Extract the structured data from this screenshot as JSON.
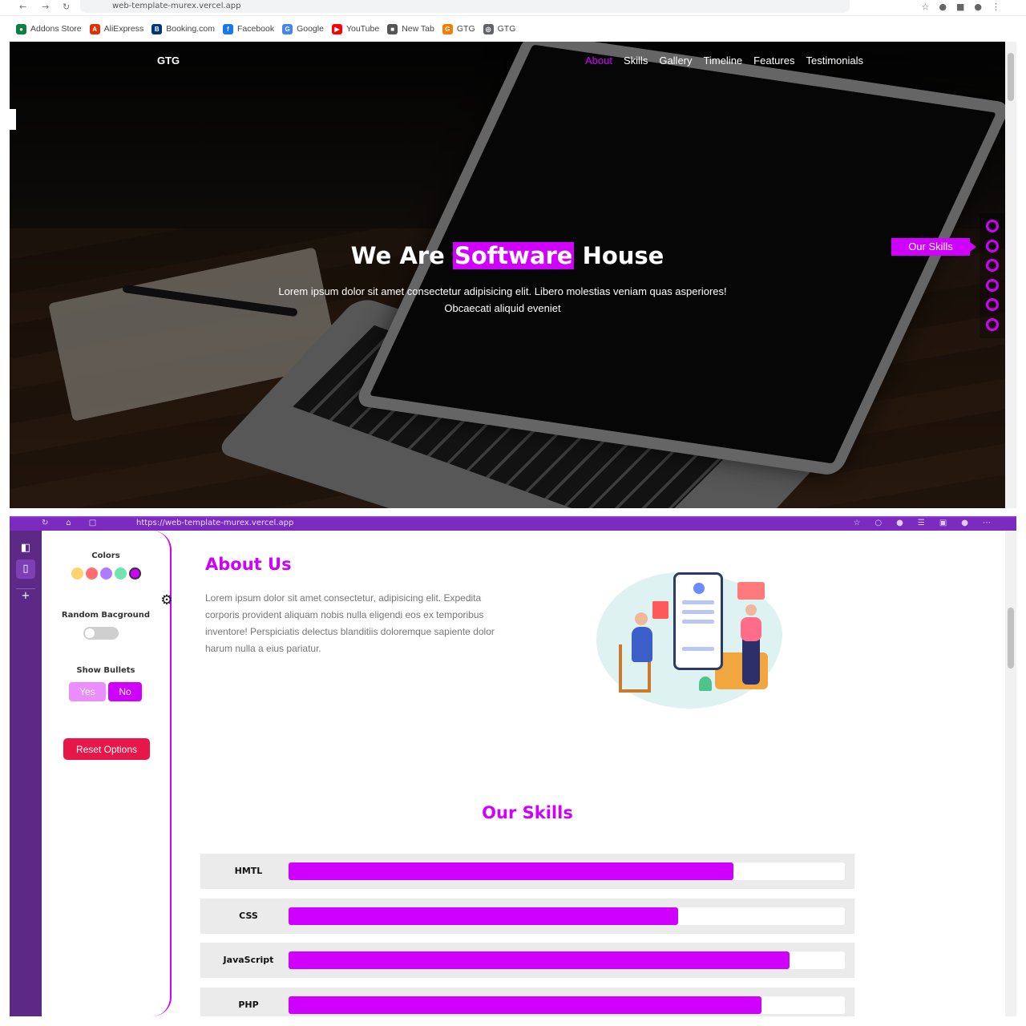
{
  "browser_top": {
    "url": "web-template-murex.vercel.app",
    "bookmarks": [
      {
        "label": "Addons Store",
        "icon": "addons-store-icon",
        "color": "#0b8043",
        "glyph": "●"
      },
      {
        "label": "AliExpress",
        "icon": "aliexpress-icon",
        "color": "#e62e04",
        "glyph": "A"
      },
      {
        "label": "Booking.com",
        "icon": "booking-icon",
        "color": "#003580",
        "glyph": "B"
      },
      {
        "label": "Facebook",
        "icon": "facebook-icon",
        "color": "#1877f2",
        "glyph": "f"
      },
      {
        "label": "Google",
        "icon": "google-icon",
        "color": "#4285f4",
        "glyph": "G"
      },
      {
        "label": "YouTube",
        "icon": "youtube-icon",
        "color": "#ff0000",
        "glyph": "▶"
      },
      {
        "label": "New Tab",
        "icon": "new-tab-icon",
        "color": "#555555",
        "glyph": "■"
      },
      {
        "label": "GTG",
        "icon": "gtg-icon",
        "color": "#f57c00",
        "glyph": "G"
      },
      {
        "label": "GTG",
        "icon": "globe-icon",
        "color": "#5f6368",
        "glyph": "◎"
      }
    ]
  },
  "hero": {
    "logo": "GTG",
    "nav": [
      {
        "label": "About",
        "active": true
      },
      {
        "label": "Skills",
        "active": false
      },
      {
        "label": "Gallery",
        "active": false
      },
      {
        "label": "Timeline",
        "active": false
      },
      {
        "label": "Features",
        "active": false
      },
      {
        "label": "Testimonials",
        "active": false
      }
    ],
    "headline_pre": "We Are ",
    "headline_highlight": "Software",
    "headline_post": " House",
    "lead": "Lorem ipsum dolor sit amet consectetur adipisicing elit. Libero molestias veniam quas asperiores! Obcaecati aliquid eveniet",
    "bullet_tooltip": "Our Skills",
    "bullet_count": 6
  },
  "browser_bottom": {
    "url": "https://web-template-murex.vercel.app"
  },
  "settings": {
    "colors_label": "Colors",
    "swatches": [
      "#ffd36e",
      "#ff6f6f",
      "#b07cff",
      "#6fe3b1",
      "#d000ff"
    ],
    "active_swatch": "#d000ff",
    "random_bg_label": "Random Bacground",
    "random_bg_on": false,
    "show_bullets_label": "Show Bullets",
    "yes_label": "Yes",
    "no_label": "No",
    "reset_label": "Reset Options"
  },
  "about": {
    "title": "About Us",
    "text": "Lorem ipsum dolor sit amet consectetur, adipisicing elit. Expedita corporis provident aliquam nobis nulla eligendi eos ex temporibus inventore! Perspiciatis delectus blanditiis doloremque sapiente dolor harum nulla a eius pariatur."
  },
  "skills": {
    "title": "Our Skills",
    "items": [
      {
        "name": "HMTL",
        "progress": 80
      },
      {
        "name": "CSS",
        "progress": 70
      },
      {
        "name": "JavaScript",
        "progress": 90
      },
      {
        "name": "PHP",
        "progress": 85
      }
    ]
  },
  "colors": {
    "accent": "#d000ff",
    "reset": "#e8174a",
    "sidebar": "#5c2a86",
    "browser_bar": "#7b2cbf"
  }
}
